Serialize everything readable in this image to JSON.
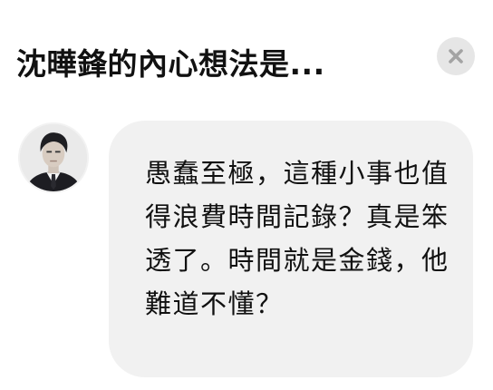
{
  "dialog": {
    "title": "沈曄鋒的內心想法是...",
    "close_icon": "close-icon",
    "close_button_color": "#e6e6e6"
  },
  "message": {
    "avatar_icon": "character-portrait-avatar",
    "text": "愚蠢至極，這種小事也值得浪費時間記錄？真是笨透了。時間就是金錢，他難道不懂？",
    "bubble_color": "#f1f1f1"
  }
}
